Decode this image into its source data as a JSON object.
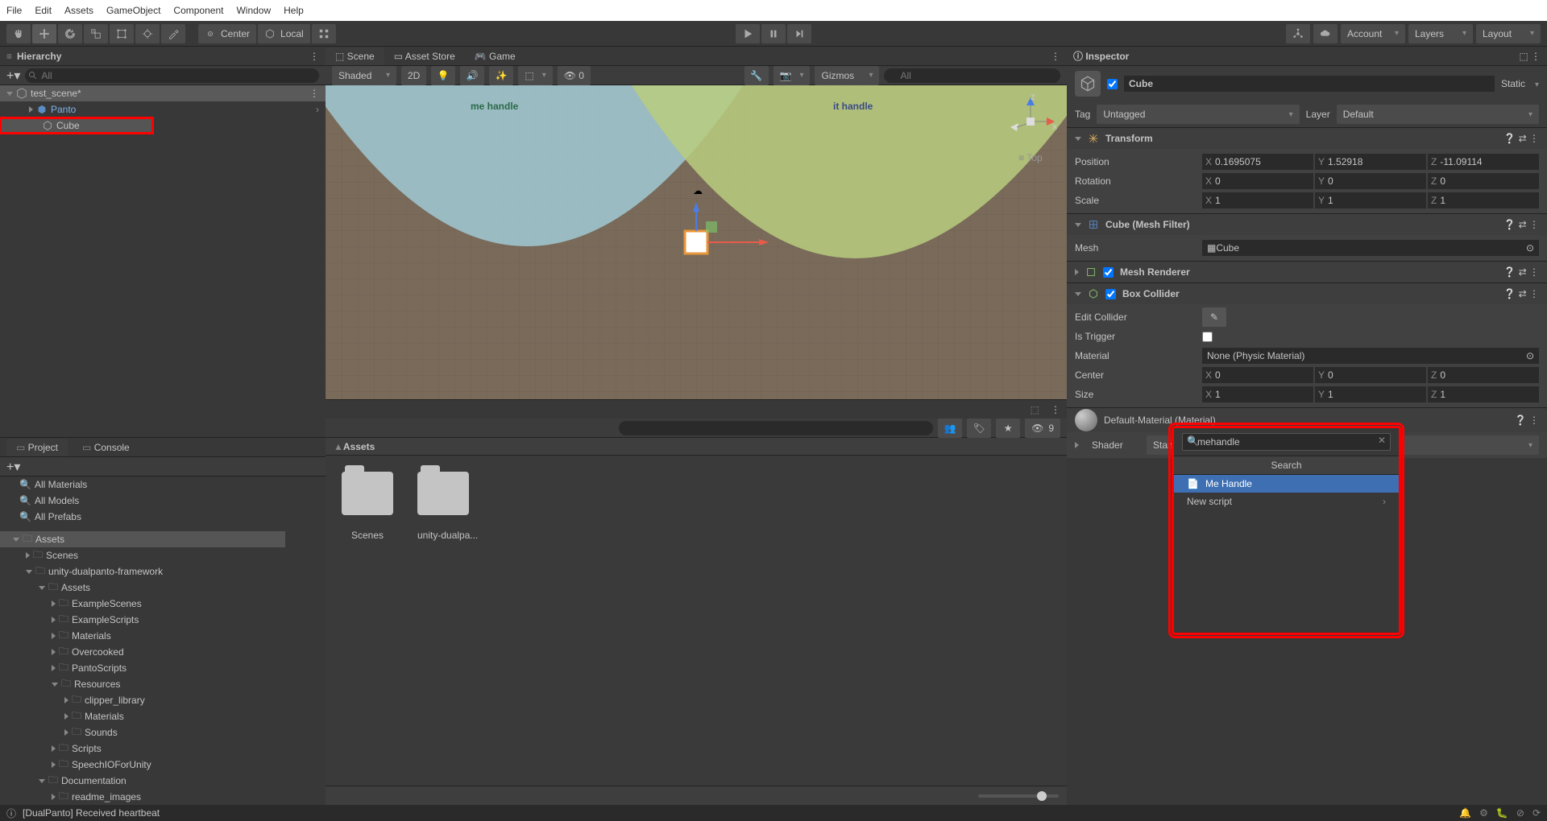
{
  "menu": [
    "File",
    "Edit",
    "Assets",
    "GameObject",
    "Component",
    "Window",
    "Help"
  ],
  "pivot": {
    "center": "Center",
    "local": "Local"
  },
  "account": "Account",
  "layers": "Layers",
  "layout": "Layout",
  "hierarchy": {
    "title": "Hierarchy",
    "search": "All",
    "scene": "test_scene*",
    "items": [
      "Panto",
      "Cube"
    ]
  },
  "sceneTabs": [
    "Scene",
    "Asset Store",
    "Game"
  ],
  "sceneToolbar": {
    "shaded": "Shaded",
    "d2": "2D",
    "gizmos": "Gizmos",
    "search": "All"
  },
  "sceneLabels": {
    "me": "me handle",
    "it": "it handle",
    "top": "Top"
  },
  "axis": {
    "x": "x",
    "z": "z"
  },
  "inspector": {
    "title": "Inspector",
    "name": "Cube",
    "static": "Static",
    "tag": "Tag",
    "tagVal": "Untagged",
    "layer": "Layer",
    "layerVal": "Default",
    "transform": "Transform",
    "position": "Position",
    "rotation": "Rotation",
    "scale": "Scale",
    "pos": {
      "x": "0.1695075",
      "y": "1.52918",
      "z": "-11.09114"
    },
    "rot": {
      "x": "0",
      "y": "0",
      "z": "0"
    },
    "scl": {
      "x": "1",
      "y": "1",
      "z": "1"
    },
    "meshFilter": "Cube (Mesh Filter)",
    "mesh": "Mesh",
    "meshVal": "Cube",
    "meshRenderer": "Mesh Renderer",
    "boxCollider": "Box Collider",
    "editCollider": "Edit Collider",
    "isTrigger": "Is Trigger",
    "material": "Material",
    "matVal": "None (Physic Material)",
    "center": "Center",
    "size": "Size",
    "cen": {
      "x": "0",
      "y": "0",
      "z": "0"
    },
    "siz": {
      "x": "1",
      "y": "1",
      "z": "1"
    },
    "defMat": "Default-Material (Material)",
    "shader": "Shader",
    "shaderVal": "Standard"
  },
  "searchPopup": {
    "query": "mehandle",
    "header": "Search",
    "items": [
      "Me Handle",
      "New script"
    ]
  },
  "project": {
    "title": "Project",
    "console": "Console",
    "filters": [
      "All Materials",
      "All Models",
      "All Prefabs"
    ],
    "tree": [
      {
        "name": "Assets",
        "depth": 0,
        "open": true
      },
      {
        "name": "Scenes",
        "depth": 1
      },
      {
        "name": "unity-dualpanto-framework",
        "depth": 1,
        "open": true
      },
      {
        "name": "Assets",
        "depth": 2,
        "open": true
      },
      {
        "name": "ExampleScenes",
        "depth": 3
      },
      {
        "name": "ExampleScripts",
        "depth": 3
      },
      {
        "name": "Materials",
        "depth": 3
      },
      {
        "name": "Overcooked",
        "depth": 3
      },
      {
        "name": "PantoScripts",
        "depth": 3
      },
      {
        "name": "Resources",
        "depth": 3,
        "open": true
      },
      {
        "name": "clipper_library",
        "depth": 4
      },
      {
        "name": "Materials",
        "depth": 4
      },
      {
        "name": "Sounds",
        "depth": 4
      },
      {
        "name": "Scripts",
        "depth": 3
      },
      {
        "name": "SpeechIOForUnity",
        "depth": 3
      },
      {
        "name": "Documentation",
        "depth": 2,
        "open": true
      },
      {
        "name": "readme_images",
        "depth": 3
      }
    ],
    "breadcrumb": "Assets",
    "folders": [
      "Scenes",
      "unity-dualpa..."
    ],
    "eyeCount": "9"
  },
  "status": "[DualPanto] Received heartbeat"
}
